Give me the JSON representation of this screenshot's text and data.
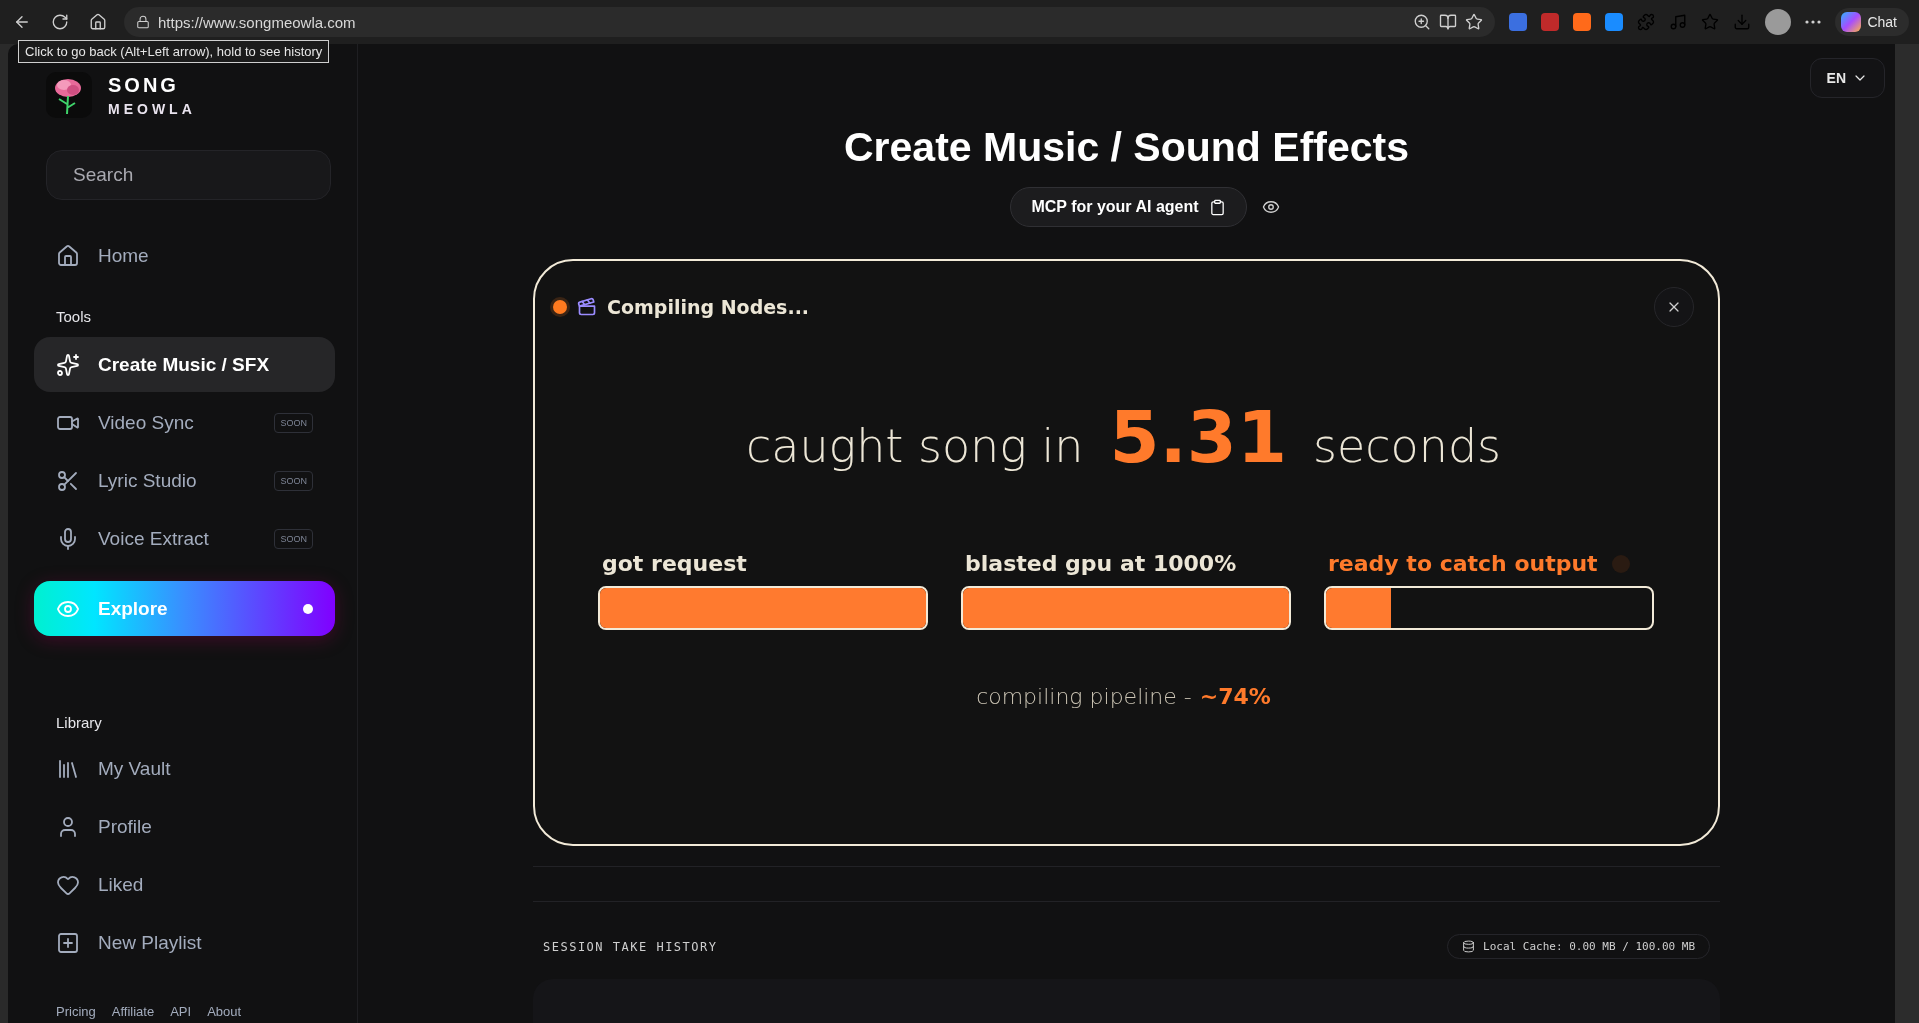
{
  "browser": {
    "url": "https://www.songmeowla.com",
    "tooltip": "Click to go back (Alt+Left arrow), hold to see history",
    "chat_button": "Chat"
  },
  "sidebar": {
    "brand": {
      "line1": "SONG",
      "line2": "MEOWLA"
    },
    "search": {
      "placeholder": "Search"
    },
    "home": {
      "label": "Home",
      "selected": false
    },
    "tools_heading": "Tools",
    "tools": [
      {
        "kind": "link",
        "label": "Create Music / SFX",
        "selected": true
      },
      {
        "kind": "link",
        "label": "Video Sync",
        "selected": false,
        "badge": "SOON"
      },
      {
        "kind": "link",
        "label": "Lyric Studio",
        "selected": false,
        "badge": "SOON"
      },
      {
        "kind": "link",
        "label": "Voice Extract",
        "selected": false,
        "badge": "SOON"
      },
      {
        "kind": "featured",
        "label": "Explore"
      }
    ],
    "library_heading": "Library",
    "library": [
      {
        "label": "My Vault",
        "selected": false
      },
      {
        "label": "Profile",
        "selected": false
      },
      {
        "label": "Liked",
        "selected": false
      },
      {
        "label": "New Playlist",
        "selected": false
      }
    ],
    "footer_links": [
      "Pricing",
      "Affiliate",
      "API",
      "About"
    ]
  },
  "main": {
    "language": "EN",
    "title": "Create Music / Sound Effects",
    "mcp_button": "MCP for your AI agent",
    "modal": {
      "status": "Compiling Nodes...",
      "headline": {
        "before": "caught song in",
        "value": "5.31",
        "after": "seconds"
      },
      "stages": [
        {
          "label": "got request",
          "level": 1,
          "highlighted": false
        },
        {
          "label": "blasted gpu at 1000%",
          "level": 1,
          "highlighted": false
        },
        {
          "label": "ready to catch output",
          "level": 0.2,
          "highlighted": true
        }
      ],
      "progress": {
        "label": "compiling pipeline -",
        "value": "~74%"
      }
    },
    "history": {
      "title": "SESSION TAKE HISTORY",
      "cache": "Local Cache: 0.00 MB / 100.00 MB"
    }
  }
}
